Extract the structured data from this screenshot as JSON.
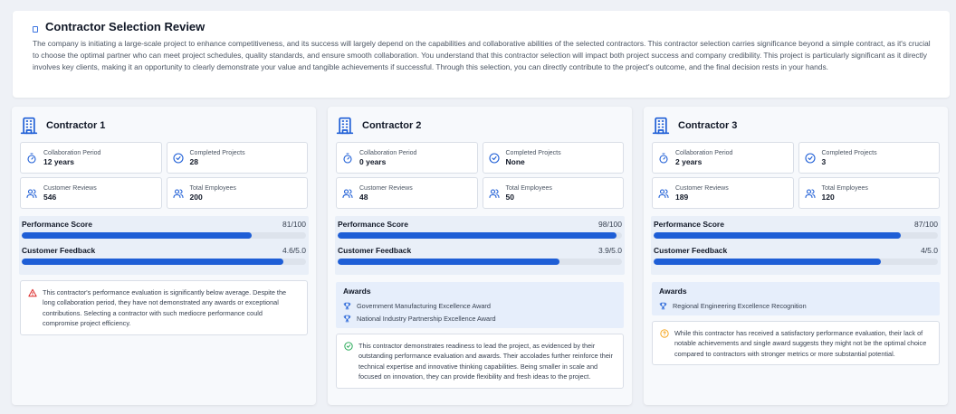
{
  "intro": {
    "title": "Contractor Selection Review",
    "body": "The company is initiating a large-scale project to enhance competitiveness, and its success will largely depend on the capabilities and collaborative abilities of the selected contractors. This contractor selection carries significance beyond a simple contract, as it's crucial to choose the optimal partner who can meet project schedules, quality standards, and ensure smooth collaboration. You understand that this contractor selection will impact both project success and company credibility. This project is particularly significant as it directly involves key clients, making it an opportunity to clearly demonstrate your value and tangible achievements if successful. Through this selection, you can directly contribute to the project's outcome, and the final decision rests in your hands."
  },
  "labels": {
    "collab": "Collaboration Period",
    "completed": "Completed Projects",
    "reviews": "Customer Reviews",
    "employees": "Total Employees",
    "performance": "Performance Score",
    "feedback": "Customer Feedback",
    "awards": "Awards"
  },
  "colors": {
    "accent": "#1e5ed6",
    "warning": "#dc2626",
    "success": "#16a34a",
    "caution": "#f59e0b"
  },
  "contractors": [
    {
      "name": "Contractor 1",
      "collab": "12 years",
      "completed": "28",
      "reviews": "546",
      "employees": "200",
      "performance_text": "81/100",
      "performance_frac": 0.81,
      "feedback_text": "4.6/5.0",
      "feedback_frac": 0.92,
      "awards": [],
      "note_icon": "warning-triangle-icon",
      "note": "This contractor's performance evaluation is significantly below average. Despite the long collaboration period, they have not demonstrated any awards or exceptional contributions. Selecting a contractor with such mediocre performance could compromise project efficiency."
    },
    {
      "name": "Contractor 2",
      "collab": "0 years",
      "completed": "None",
      "reviews": "48",
      "employees": "50",
      "performance_text": "98/100",
      "performance_frac": 0.98,
      "feedback_text": "3.9/5.0",
      "feedback_frac": 0.78,
      "awards": [
        "Government Manufacturing Excellence Award",
        "National Industry Partnership Excellence Award"
      ],
      "note_icon": "check-circle-icon",
      "note": "This contractor demonstrates readiness to lead the project, as evidenced by their outstanding performance evaluation and awards. Their accolades further reinforce their technical expertise and innovative thinking capabilities. Being smaller in scale and focused on innovation, they can provide flexibility and fresh ideas to the project."
    },
    {
      "name": "Contractor 3",
      "collab": "2 years",
      "completed": "3",
      "reviews": "189",
      "employees": "120",
      "performance_text": "87/100",
      "performance_frac": 0.87,
      "feedback_text": "4/5.0",
      "feedback_frac": 0.8,
      "awards": [
        "Regional Engineering Excellence Recognition"
      ],
      "note_icon": "question-circle-icon",
      "note": "While this contractor has received a satisfactory performance evaluation, their lack of notable achievements and single award suggests they might not be the optimal choice compared to contractors with stronger metrics or more substantial potential."
    }
  ]
}
